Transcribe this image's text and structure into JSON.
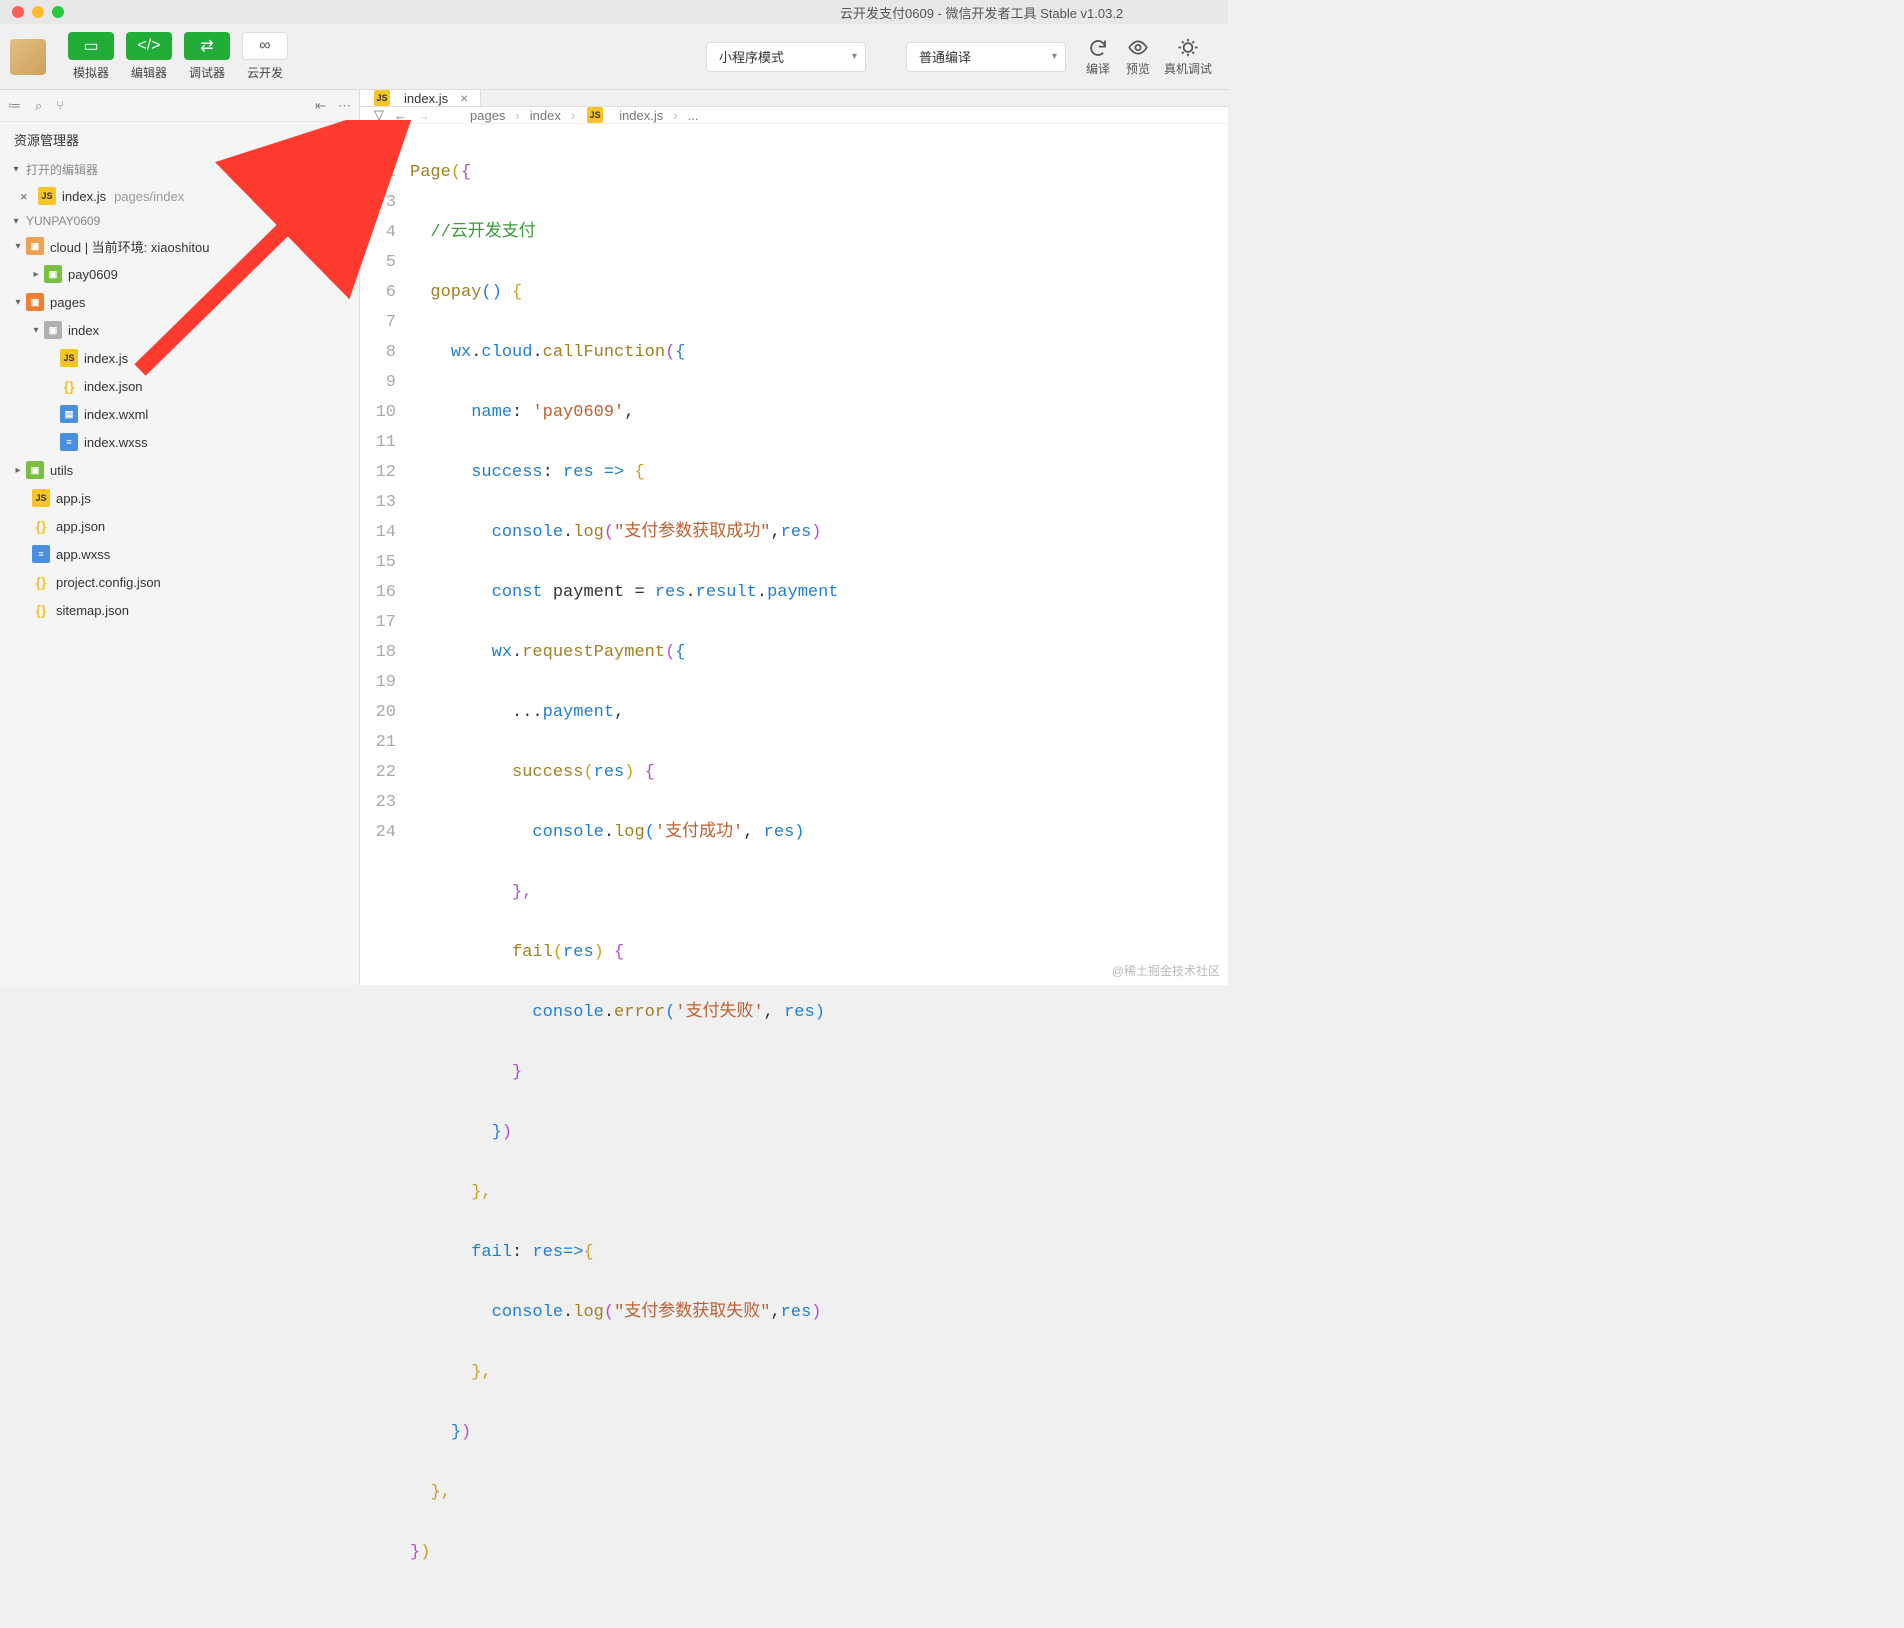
{
  "window": {
    "title": "云开发支付0609 - 微信开发者工具 Stable v1.03.2"
  },
  "toolbar": {
    "simulator": "模拟器",
    "editor": "编辑器",
    "debugger": "调试器",
    "cloudDev": "云开发",
    "modeSelect": "小程序模式",
    "compileSelect": "普通编译",
    "compile": "编译",
    "preview": "预览",
    "realDevice": "真机调试"
  },
  "sidebar": {
    "header": "资源管理器",
    "openEditorsLabel": "打开的编辑器",
    "openEditor": {
      "name": "index.js",
      "path": "pages/index"
    },
    "project": "YUNPAY0609",
    "tree": {
      "cloud": "cloud | 当前环境: xiaoshitou",
      "pay": "pay0609",
      "pages": "pages",
      "index": "index",
      "indexjs": "index.js",
      "indexjson": "index.json",
      "indexwxml": "index.wxml",
      "indexwxss": "index.wxss",
      "utils": "utils",
      "appjs": "app.js",
      "appjson": "app.json",
      "appwxss": "app.wxss",
      "projconf": "project.config.json",
      "sitemap": "sitemap.json"
    }
  },
  "tab": {
    "name": "index.js"
  },
  "breadcrumb": {
    "p1": "pages",
    "p2": "index",
    "p3": "index.js",
    "p4": "..."
  },
  "code": {
    "l1a": "Page",
    "l1b": "(",
    "l1c": "{",
    "l2": "//云开发支付",
    "l3a": "gopay",
    "l3b": "()",
    "l3c": " {",
    "l4a": "wx",
    "l4b": ".",
    "l4c": "cloud",
    "l4d": ".",
    "l4e": "callFunction",
    "l4f": "(",
    "l4g": "{",
    "l5a": "name",
    "l5b": ": ",
    "l5c": "'pay0609'",
    "l5d": ",",
    "l6a": "success",
    "l6b": ": ",
    "l6c": "res",
    "l6d": " => ",
    "l6e": "{",
    "l7a": "console",
    "l7b": ".",
    "l7c": "log",
    "l7d": "(",
    "l7e": "\"支付参数获取成功\"",
    "l7f": ",",
    "l7g": "res",
    "l7h": ")",
    "l8a": "const",
    "l8b": " payment = ",
    "l8c": "res",
    "l8d": ".",
    "l8e": "result",
    "l8f": ".",
    "l8g": "payment",
    "l9a": "wx",
    "l9b": ".",
    "l9c": "requestPayment",
    "l9d": "(",
    "l9e": "{",
    "l10a": "...",
    "l10b": "payment",
    "l10c": ",",
    "l11a": "success",
    "l11b": "(",
    "l11c": "res",
    "l11d": ")",
    "l11e": " {",
    "l12a": "console",
    "l12b": ".",
    "l12c": "log",
    "l12d": "(",
    "l12e": "'支付成功'",
    "l12f": ", ",
    "l12g": "res",
    "l12h": ")",
    "l13": "},",
    "l14a": "fail",
    "l14b": "(",
    "l14c": "res",
    "l14d": ")",
    "l14e": " {",
    "l15a": "console",
    "l15b": ".",
    "l15c": "error",
    "l15d": "(",
    "l15e": "'支付失败'",
    "l15f": ", ",
    "l15g": "res",
    "l15h": ")",
    "l16": "}",
    "l17a": "}",
    "l17b": ")",
    "l18": "},",
    "l19a": "fail",
    "l19b": ": ",
    "l19c": "res",
    "l19d": "=>",
    "l19e": "{",
    "l20a": "console",
    "l20b": ".",
    "l20c": "log",
    "l20d": "(",
    "l20e": "\"支付参数获取失败\"",
    "l20f": ",",
    "l20g": "res",
    "l20h": ")",
    "l21": "},",
    "l22a": "}",
    "l22b": ")",
    "l23": "},",
    "l24a": "}",
    "l24b": ")"
  },
  "watermark": "@稀土掘金技术社区"
}
